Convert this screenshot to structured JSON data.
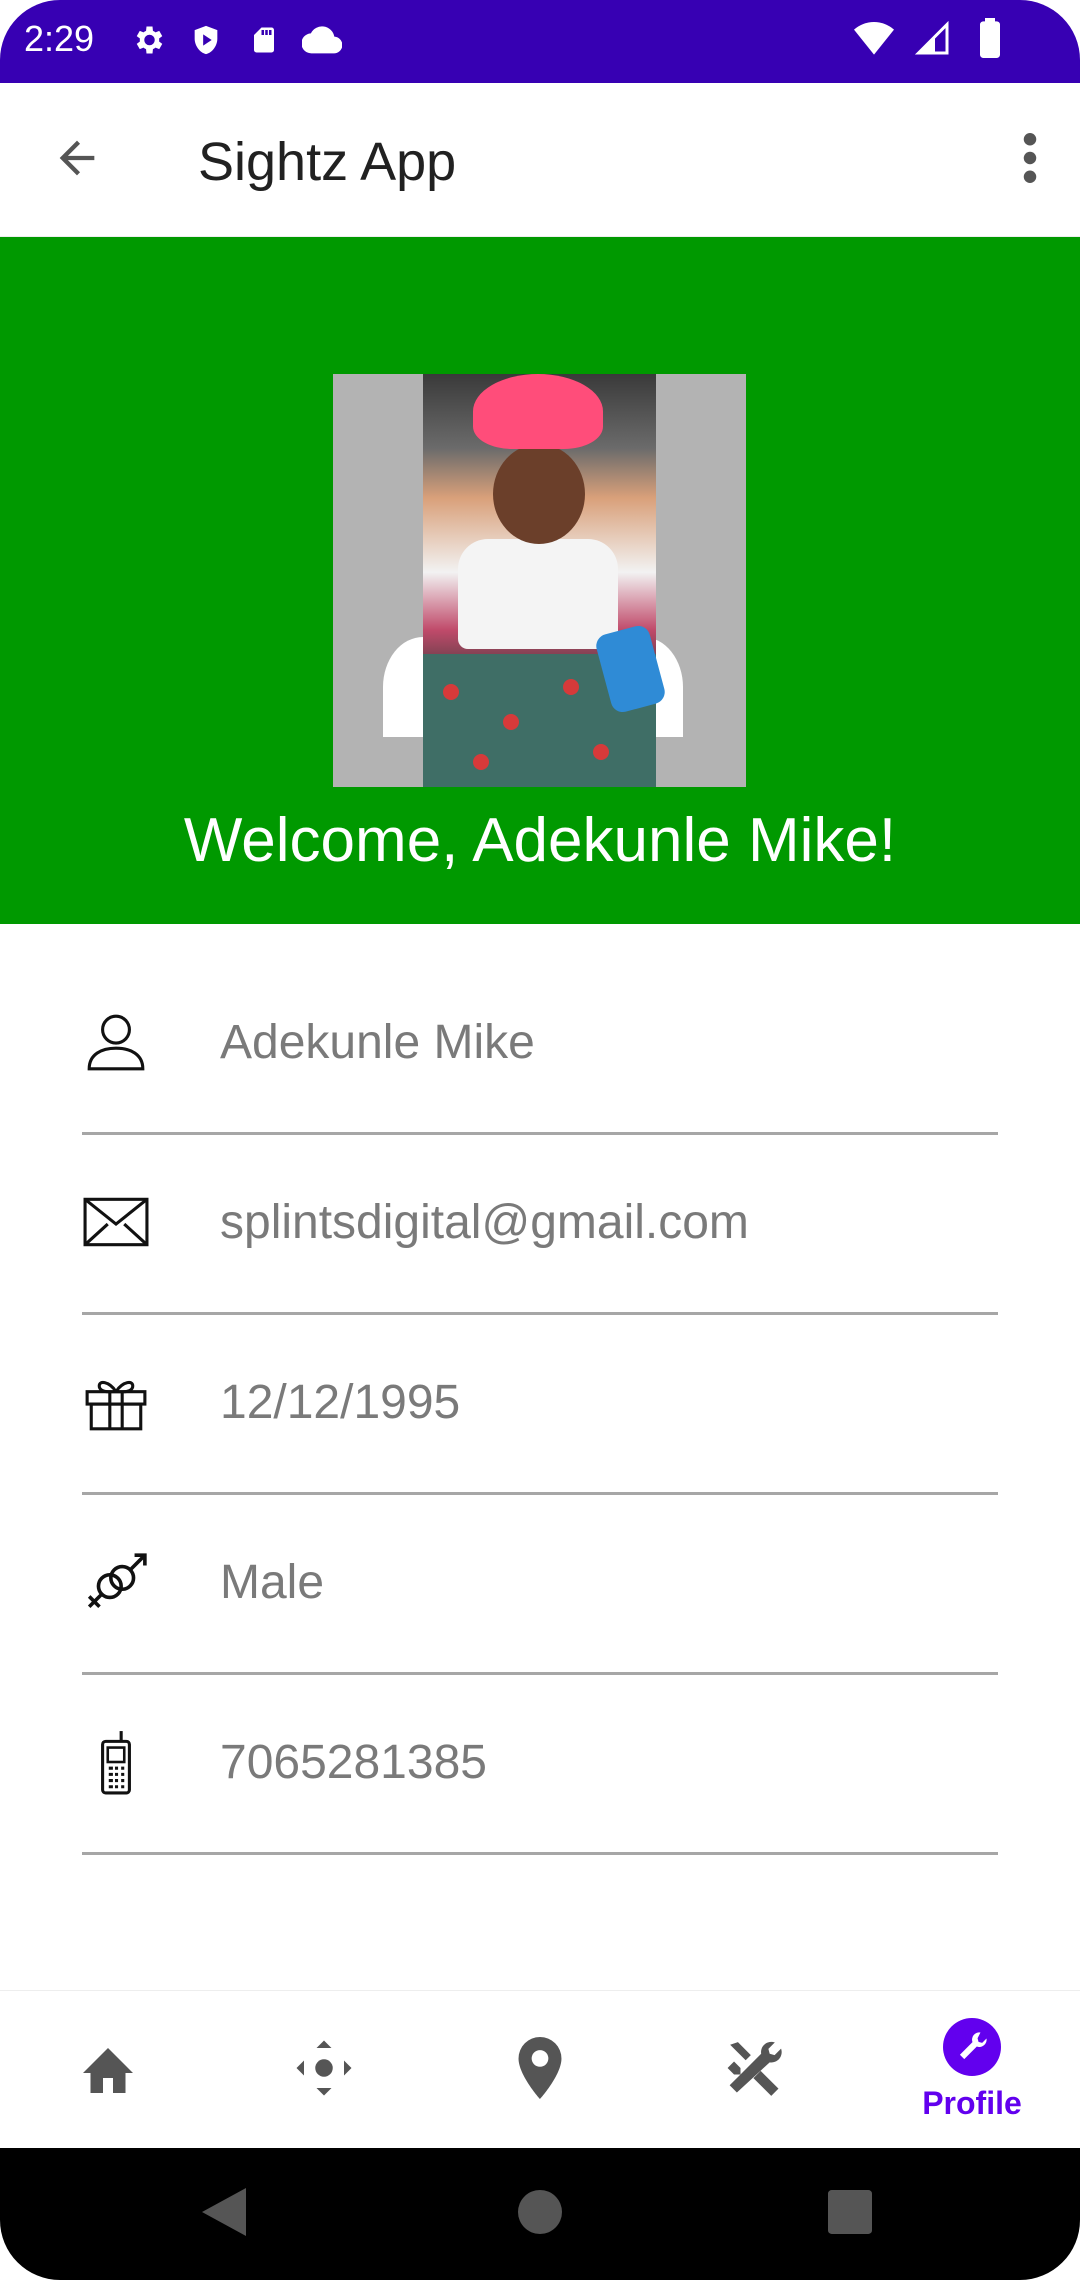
{
  "status_bar": {
    "time": "2:29",
    "icons_left": [
      "gear-icon",
      "shield-play-icon",
      "sd-card-icon",
      "cloud-icon"
    ],
    "icons_right": [
      "wifi-icon",
      "signal-icon",
      "battery-icon"
    ]
  },
  "app_bar": {
    "title": "Sightz App",
    "back_icon": "arrow-back-icon",
    "menu_icon": "more-vert-icon"
  },
  "banner": {
    "background": "#009900",
    "welcome": "Welcome, Adekunle  Mike!"
  },
  "profile": {
    "name": "Adekunle  Mike",
    "email": "splintsdigital@gmail.com",
    "birthday": "12/12/1995",
    "gender": "Male",
    "phone": "7065281385"
  },
  "bottom_nav": {
    "items": [
      {
        "icon": "home-icon",
        "label": ""
      },
      {
        "icon": "move-icon",
        "label": ""
      },
      {
        "icon": "location-pin-icon",
        "label": ""
      },
      {
        "icon": "tools-icon",
        "label": ""
      },
      {
        "icon": "profile-wrench-icon",
        "label": "Profile",
        "active": true
      }
    ],
    "active_color": "#6200EE",
    "inactive_color": "#555555"
  },
  "system_nav": [
    "back-triangle-icon",
    "home-circle-icon",
    "recents-square-icon"
  ],
  "colors": {
    "status_bar": "#3700B3",
    "accent": "#6200EE",
    "banner": "#009900"
  }
}
